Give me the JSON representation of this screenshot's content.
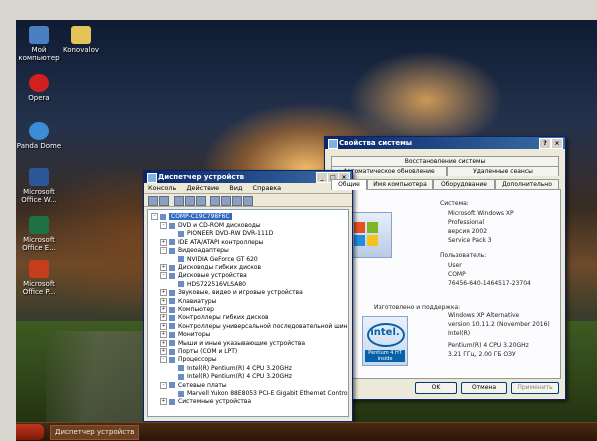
{
  "desktop": {
    "icons": [
      {
        "label": "Мой компьютер",
        "icon": "my-computer-icon",
        "color": "#4a7fc1"
      },
      {
        "label": "Konovalov",
        "icon": "folder-icon",
        "color": "#e3c45a"
      },
      {
        "label": "Opera",
        "icon": "opera-icon",
        "color": "#d41f1f"
      },
      {
        "label": "Panda Dome",
        "icon": "panda-icon",
        "color": "#3b8ed6"
      },
      {
        "label": "Microsoft Office W...",
        "icon": "word-icon",
        "color": "#2b5797"
      },
      {
        "label": "Microsoft Office E...",
        "icon": "excel-icon",
        "color": "#1e7145"
      },
      {
        "label": "Microsoft Office P...",
        "icon": "powerpoint-icon",
        "color": "#c43e1c"
      }
    ]
  },
  "taskbar": {
    "tasks": [
      "Диспетчер устройств"
    ]
  },
  "device_manager": {
    "title": "Диспетчер устройств",
    "menu": [
      "Консоль",
      "Действие",
      "Вид",
      "Справка"
    ],
    "root": "COMP-C19C798F6C",
    "nodes": [
      {
        "label": "DVD и CD-ROM дисководы",
        "indent": 1,
        "exp": "-"
      },
      {
        "label": "PIONEER DVD-RW DVR-111D",
        "indent": 2,
        "exp": ""
      },
      {
        "label": "IDE ATA/ATAPI контроллеры",
        "indent": 1,
        "exp": "+"
      },
      {
        "label": "Видеоадаптеры",
        "indent": 1,
        "exp": "-"
      },
      {
        "label": "NVIDIA GeForce GT 620",
        "indent": 2,
        "exp": ""
      },
      {
        "label": "Дисководы гибких дисков",
        "indent": 1,
        "exp": "+"
      },
      {
        "label": "Дисковые устройства",
        "indent": 1,
        "exp": "-"
      },
      {
        "label": "HDS722516VLSA80",
        "indent": 2,
        "exp": ""
      },
      {
        "label": "Звуковые, видео и игровые устройства",
        "indent": 1,
        "exp": "+"
      },
      {
        "label": "Клавиатуры",
        "indent": 1,
        "exp": "+"
      },
      {
        "label": "Компьютер",
        "indent": 1,
        "exp": "+"
      },
      {
        "label": "Контроллеры гибких дисков",
        "indent": 1,
        "exp": "+"
      },
      {
        "label": "Контроллеры универсальной последовательной шины USB",
        "indent": 1,
        "exp": "+"
      },
      {
        "label": "Мониторы",
        "indent": 1,
        "exp": "+"
      },
      {
        "label": "Мыши и иные указывающие устройства",
        "indent": 1,
        "exp": "+"
      },
      {
        "label": "Порты (COM и LPT)",
        "indent": 1,
        "exp": "+"
      },
      {
        "label": "Процессоры",
        "indent": 1,
        "exp": "-"
      },
      {
        "label": "Intel(R) Pentium(R) 4 CPU 3.20GHz",
        "indent": 2,
        "exp": ""
      },
      {
        "label": "Intel(R) Pentium(R) 4 CPU 3.20GHz",
        "indent": 2,
        "exp": ""
      },
      {
        "label": "Сетевые платы",
        "indent": 1,
        "exp": "-"
      },
      {
        "label": "Marvell Yukon 88E8053 PCI-E Gigabit Ethernet Controller",
        "indent": 2,
        "exp": ""
      },
      {
        "label": "Системные устройства",
        "indent": 1,
        "exp": "+"
      }
    ]
  },
  "system_properties": {
    "title": "Свойства системы",
    "tabs_row1": [
      "Восстановление системы"
    ],
    "tabs_row2": [
      "Автоматическое обновление",
      "Удаленные сеансы"
    ],
    "tabs_row3": [
      "Общие",
      "Имя компьютера",
      "Оборудование",
      "Дополнительно"
    ],
    "system_label": "Система:",
    "system_lines": [
      "Microsoft Windows XP",
      "Professional",
      "версия 2002",
      "Service Pack 3"
    ],
    "user_label": "Пользователь:",
    "user_lines": [
      "User",
      "COMP",
      "76456-640-1464517-23704"
    ],
    "vendor_label": "Изготовлено и поддержка:",
    "vendor_lines": [
      "Windows XP Alternative",
      "version 10.11.2 (November 2016)",
      "Intel(R)",
      "Pentium(R) 4 CPU 3.20GHz",
      "3.21 ГГц, 2.00 ГБ ОЗУ"
    ],
    "logo_text": "intel.",
    "logo_sub": "Pentium 4 HT",
    "logo_sub2": "inside",
    "buttons": [
      "OK",
      "Отмена",
      "Применить"
    ]
  }
}
